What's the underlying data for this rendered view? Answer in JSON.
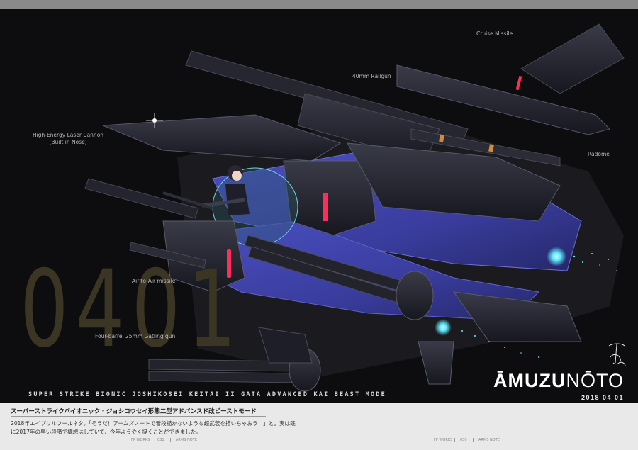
{
  "big_number": "0401",
  "callouts": {
    "cruise_missile": "Cruise Missile",
    "railgun": "40mm Railgun",
    "laser_cannon_line1": "High-Energy Laser Cannon",
    "laser_cannon_line2": "(Built in Nose)",
    "radome": "Radome",
    "air_to_air": "Air-to-Air missile",
    "gatling": "Four-barrel 25mm Gatling gun"
  },
  "subtitle": "SUPER STRIKE BIONIC JOSHIKOSEI KEITAI II GATA ADVANCED KAI BEAST MODE",
  "title_bold": "ĀMUZU",
  "title_light": "NŌTO",
  "date": "2018 04 01",
  "signature_text": "Tokoi",
  "info": {
    "title": "スーパーストライクバイオニック・ジョシコウセイ形態二型アドバンスド改ビーストモード",
    "body_line1": "2018年エイプリルフールネタ。「そうだ！アームズノートで普段描かないような超武装を描いちゃおう！」と。実は既",
    "body_line2": "に2017年の早い段階で構想はしていて、今年ようやく描くことができました。"
  },
  "footer": {
    "left_section": "FP WORKS",
    "left_page": "031",
    "left_label": "ARMS NOTE",
    "right_section": "FP WORKS",
    "right_page": "030",
    "right_label": "ARMS NOTE"
  },
  "colors": {
    "background": "#0d0d0f",
    "hull_blue": "#3a3d9e",
    "hull_dark": "#1c1d2a",
    "accent_red": "#ff2d5a",
    "thruster_cyan": "#5fe8ff",
    "number_tint": "#3b3523"
  }
}
